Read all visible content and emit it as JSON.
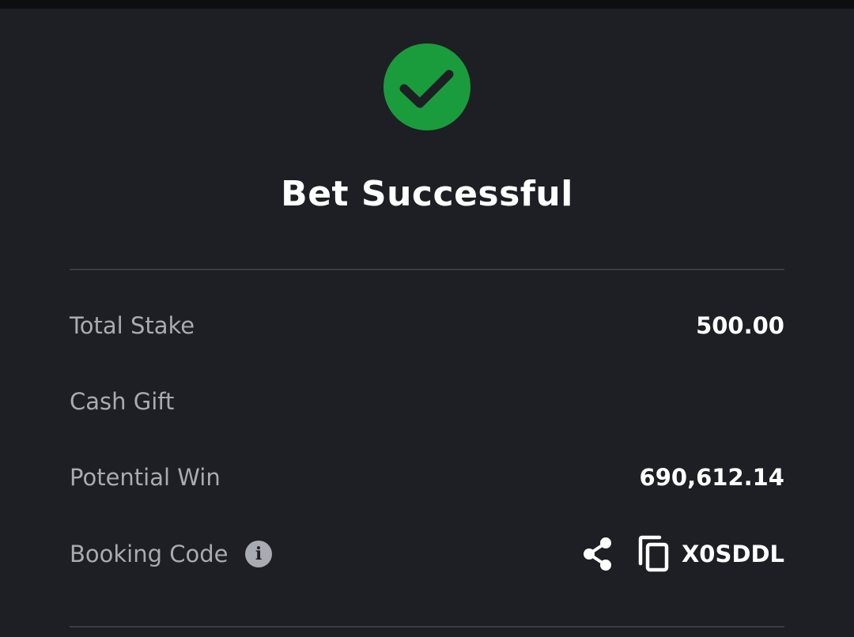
{
  "header": {
    "status_icon": "check-circle-icon",
    "title": "Bet Successful"
  },
  "summary": {
    "total_stake": {
      "label": "Total Stake",
      "value": "500.00"
    },
    "cash_gift": {
      "label": "Cash Gift",
      "value": ""
    },
    "potential_win": {
      "label": "Potential Win",
      "value": "690,612.14"
    },
    "booking_code": {
      "label": "Booking Code",
      "info_icon": "info-icon",
      "share_icon": "share-icon",
      "copy_icon": "copy-icon",
      "value": "X0SDDL"
    }
  },
  "colors": {
    "background": "#1e1f24",
    "success_green": "#1a9c3c",
    "label_gray": "#a9abb2",
    "value_white": "#ffffff",
    "divider": "#3b3d44"
  }
}
